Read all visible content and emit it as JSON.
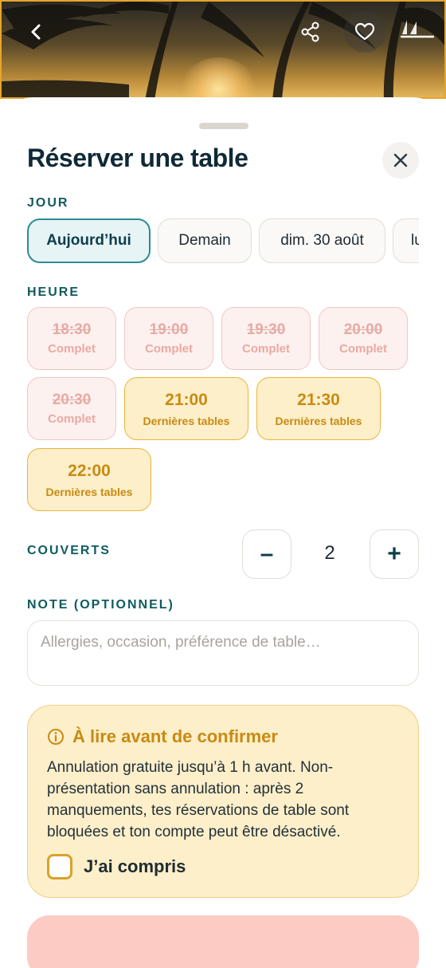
{
  "hero": {
    "back_icon": "chevron-left-icon",
    "share_icon": "share-icon",
    "favorite_icon": "heart-icon",
    "boat_icon": "sailboat-icon"
  },
  "sheet": {
    "title": "Réserver une table",
    "close_icon": "close-icon"
  },
  "day": {
    "label": "JOUR",
    "options": [
      "Aujourd’hui",
      "Demain",
      "dim. 30 août",
      "lu"
    ],
    "selected": "Aujourd’hui"
  },
  "hour": {
    "label": "HEURE",
    "slots": [
      {
        "time": "18:30",
        "status": "Complet"
      },
      {
        "time": "19:00",
        "status": "Complet"
      },
      {
        "time": "19:30",
        "status": "Complet"
      },
      {
        "time": "20:00",
        "status": "Complet"
      },
      {
        "time": "20:30",
        "status": "Complet"
      },
      {
        "time": "21:00",
        "status": "Dernières tables"
      },
      {
        "time": "21:30",
        "status": "Dernières tables"
      },
      {
        "time": "22:00",
        "status": "Dernières tables"
      }
    ]
  },
  "covers": {
    "label": "COUVERTS",
    "minus": "–",
    "plus": "+",
    "value": "2"
  },
  "note": {
    "label": "NOTE (OPTIONNEL)",
    "placeholder": "Allergies, occasion, préférence de table…",
    "value": ""
  },
  "notice": {
    "icon": "info-icon",
    "title": "À lire avant de confirmer",
    "text": "Annulation gratuite jusqu’à 1 h avant. Non-présentation sans annulation : après 2 manquements, tes réservations de table sont bloquées et ton compte peut être désactivé.",
    "checkbox_label": "J’ai compris",
    "checked": false
  },
  "colors": {
    "accent_teal": "#2a8c94",
    "full_red": "#eaa9a2",
    "last_amber": "#c98a12",
    "confirm_disabled": "#fccbc3"
  }
}
